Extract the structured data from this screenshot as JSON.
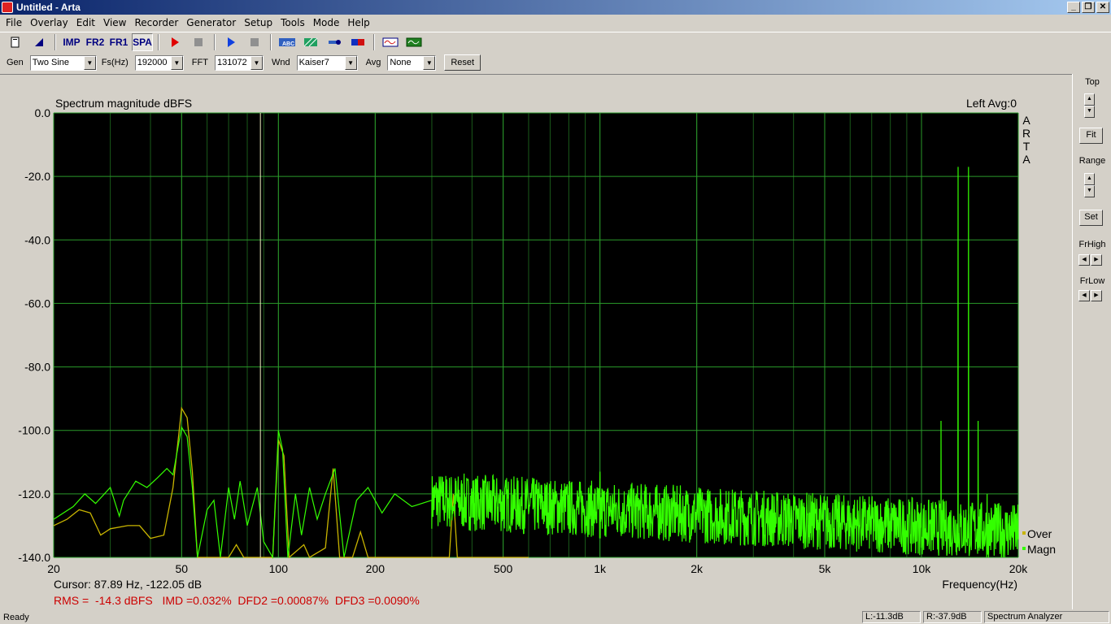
{
  "window": {
    "title": "Untitled - Arta"
  },
  "menu": [
    "File",
    "Overlay",
    "Edit",
    "View",
    "Recorder",
    "Generator",
    "Setup",
    "Tools",
    "Mode",
    "Help"
  ],
  "toolbar": [
    {
      "icon": "new-document-icon"
    },
    {
      "icon": "open-icon"
    },
    {
      "label": "IMP"
    },
    {
      "label": "FR2"
    },
    {
      "label": "FR1"
    },
    {
      "label": "SPA",
      "pressed": true
    },
    {
      "icon": "record-icon"
    },
    {
      "icon": "stop-icon"
    },
    {
      "icon": "play-icon"
    },
    {
      "icon": "stop-icon"
    },
    {
      "icon": "abc-icon"
    },
    {
      "icon": "hatch-icon"
    },
    {
      "icon": "probe-icon"
    },
    {
      "icon": "meter-icon"
    },
    {
      "icon": "waveform-icon"
    },
    {
      "icon": "oscilloscope-icon"
    }
  ],
  "controls": {
    "gen_label": "Gen",
    "gen_value": "Two Sine",
    "fs_label": "Fs(Hz)",
    "fs_value": "192000",
    "fft_label": "FFT",
    "fft_value": "131072",
    "wnd_label": "Wnd",
    "wnd_value": "Kaiser7",
    "avg_label": "Avg",
    "avg_value": "None",
    "reset_label": "Reset"
  },
  "right_panel": {
    "top": "Top",
    "fit": "Fit",
    "range": "Range",
    "set": "Set",
    "frhigh": "FrHigh",
    "frlow": "FrLow"
  },
  "plot": {
    "title": "Spectrum magnitude dBFS",
    "channel": "Left  Avg:0",
    "watermark": [
      "A",
      "R",
      "T",
      "A"
    ],
    "xlabel": "Frequency(Hz)",
    "cursor": "Cursor: 87.89 Hz, -122.05 dB",
    "metrics": "RMS =  -14.3 dBFS   IMD =0.032%  DFD2 =0.00087%  DFD3 =0.0090%",
    "legend": [
      {
        "name": "Over",
        "color": "#c8b400"
      },
      {
        "name": "Magn",
        "color": "#33ff00"
      }
    ]
  },
  "chart_data": {
    "type": "line",
    "xscale": "log",
    "xlim": [
      20,
      20000
    ],
    "ylim": [
      -140,
      0
    ],
    "yticks": [
      0,
      -20,
      -40,
      -60,
      -80,
      -100,
      -120,
      -140
    ],
    "ytick_labels": [
      "0.0",
      "-20.0",
      "-40.0",
      "-60.0",
      "-80.0",
      "-100.0",
      "-120.0",
      "-140.0"
    ],
    "xticks": [
      20,
      50,
      100,
      200,
      500,
      1000,
      2000,
      5000,
      10000,
      20000
    ],
    "xtick_labels": [
      "20",
      "50",
      "100",
      "200",
      "500",
      "1k",
      "2k",
      "5k",
      "10k",
      "20k"
    ],
    "grid": true,
    "cursor_x": 87.89,
    "series": [
      {
        "name": "Magn",
        "color": "#33ff00",
        "points": [
          [
            20,
            -128
          ],
          [
            23,
            -124
          ],
          [
            25,
            -120
          ],
          [
            27,
            -123
          ],
          [
            30,
            -118
          ],
          [
            32,
            -127
          ],
          [
            33,
            -122
          ],
          [
            36,
            -116
          ],
          [
            39,
            -118
          ],
          [
            42,
            -115
          ],
          [
            45,
            -112
          ],
          [
            47,
            -114
          ],
          [
            50,
            -99
          ],
          [
            52,
            -102
          ],
          [
            54,
            -118
          ],
          [
            56,
            -140
          ],
          [
            60,
            -125
          ],
          [
            63,
            -122
          ],
          [
            66,
            -140
          ],
          [
            70,
            -118
          ],
          [
            73,
            -128
          ],
          [
            76,
            -116
          ],
          [
            80,
            -130
          ],
          [
            86,
            -118
          ],
          [
            90,
            -135
          ],
          [
            96,
            -140
          ],
          [
            100,
            -100
          ],
          [
            103,
            -106
          ],
          [
            107,
            -140
          ],
          [
            113,
            -120
          ],
          [
            118,
            -133
          ],
          [
            125,
            -118
          ],
          [
            132,
            -128
          ],
          [
            140,
            -120
          ],
          [
            150,
            -112
          ],
          [
            160,
            -140
          ],
          [
            175,
            -122
          ],
          [
            190,
            -118
          ],
          [
            210,
            -126
          ],
          [
            230,
            -120
          ],
          [
            260,
            -124
          ],
          [
            300,
            -122
          ],
          [
            350,
            -125
          ],
          [
            400,
            -122
          ],
          [
            500,
            -126
          ],
          [
            700,
            -128
          ],
          [
            1000,
            -113
          ],
          [
            1300,
            -128
          ],
          [
            2000,
            -130
          ],
          [
            3000,
            -131
          ],
          [
            5000,
            -133
          ],
          [
            8000,
            -134
          ],
          [
            11000,
            -132
          ],
          [
            11500,
            -97
          ],
          [
            12000,
            -134
          ],
          [
            13000,
            -17
          ],
          [
            13500,
            -134
          ],
          [
            14000,
            -17
          ],
          [
            14500,
            -134
          ],
          [
            15000,
            -97
          ],
          [
            16000,
            -120
          ],
          [
            17000,
            -134
          ],
          [
            20000,
            -135
          ]
        ],
        "noise_floor_db": [
          -127,
          -140
        ],
        "spikes": [
          [
            11500,
            -97
          ],
          [
            13000,
            -17
          ],
          [
            14000,
            -17
          ],
          [
            15000,
            -97
          ],
          [
            1000,
            -113
          ],
          [
            16000,
            -120
          ]
        ]
      },
      {
        "name": "Over",
        "color": "#c8b400",
        "points": [
          [
            20,
            -130
          ],
          [
            22,
            -128
          ],
          [
            24,
            -125
          ],
          [
            26,
            -126
          ],
          [
            28,
            -133
          ],
          [
            30,
            -131
          ],
          [
            34,
            -130
          ],
          [
            37,
            -130
          ],
          [
            40,
            -134
          ],
          [
            44,
            -133
          ],
          [
            47,
            -118
          ],
          [
            50,
            -93
          ],
          [
            52,
            -96
          ],
          [
            54,
            -113
          ],
          [
            56,
            -140
          ],
          [
            58,
            -140
          ],
          [
            70,
            -140
          ],
          [
            74,
            -136
          ],
          [
            78,
            -140
          ],
          [
            96,
            -140
          ],
          [
            100,
            -103
          ],
          [
            104,
            -108
          ],
          [
            108,
            -140
          ],
          [
            120,
            -136
          ],
          [
            125,
            -140
          ],
          [
            140,
            -137
          ],
          [
            148,
            -112
          ],
          [
            155,
            -140
          ],
          [
            170,
            -140
          ],
          [
            180,
            -132
          ],
          [
            190,
            -140
          ],
          [
            340,
            -140
          ],
          [
            350,
            -120
          ],
          [
            360,
            -140
          ],
          [
            500,
            -140
          ],
          [
            600,
            -140
          ]
        ]
      }
    ]
  },
  "status": {
    "ready": "Ready",
    "left": "L:-11.3dB",
    "right": "R:-37.9dB",
    "mode": "Spectrum Analyzer"
  }
}
